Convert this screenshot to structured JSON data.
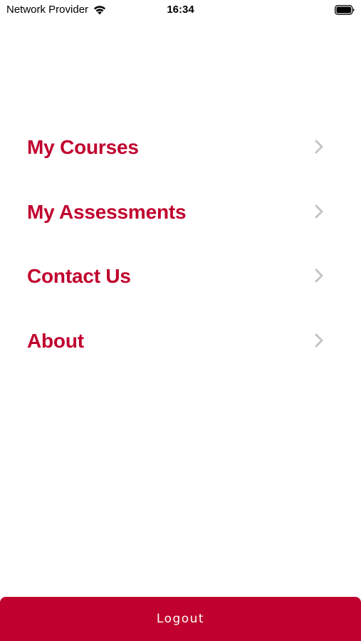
{
  "status_bar": {
    "carrier": "Network Provider",
    "time": "16:34",
    "icons": [
      "wifi-icon",
      "battery-icon"
    ]
  },
  "menu": {
    "items": [
      {
        "label": "My Courses",
        "icon": "chevron-right-icon"
      },
      {
        "label": "My Assessments",
        "icon": "chevron-right-icon"
      },
      {
        "label": "Contact Us",
        "icon": "chevron-right-icon"
      },
      {
        "label": "About",
        "icon": "chevron-right-icon"
      }
    ]
  },
  "logout": {
    "label": "Logout"
  },
  "colors": {
    "accent": "#c0002e",
    "chevron": "#c4c4c6",
    "background": "#ffffff",
    "text_on_accent": "#ffffff"
  }
}
